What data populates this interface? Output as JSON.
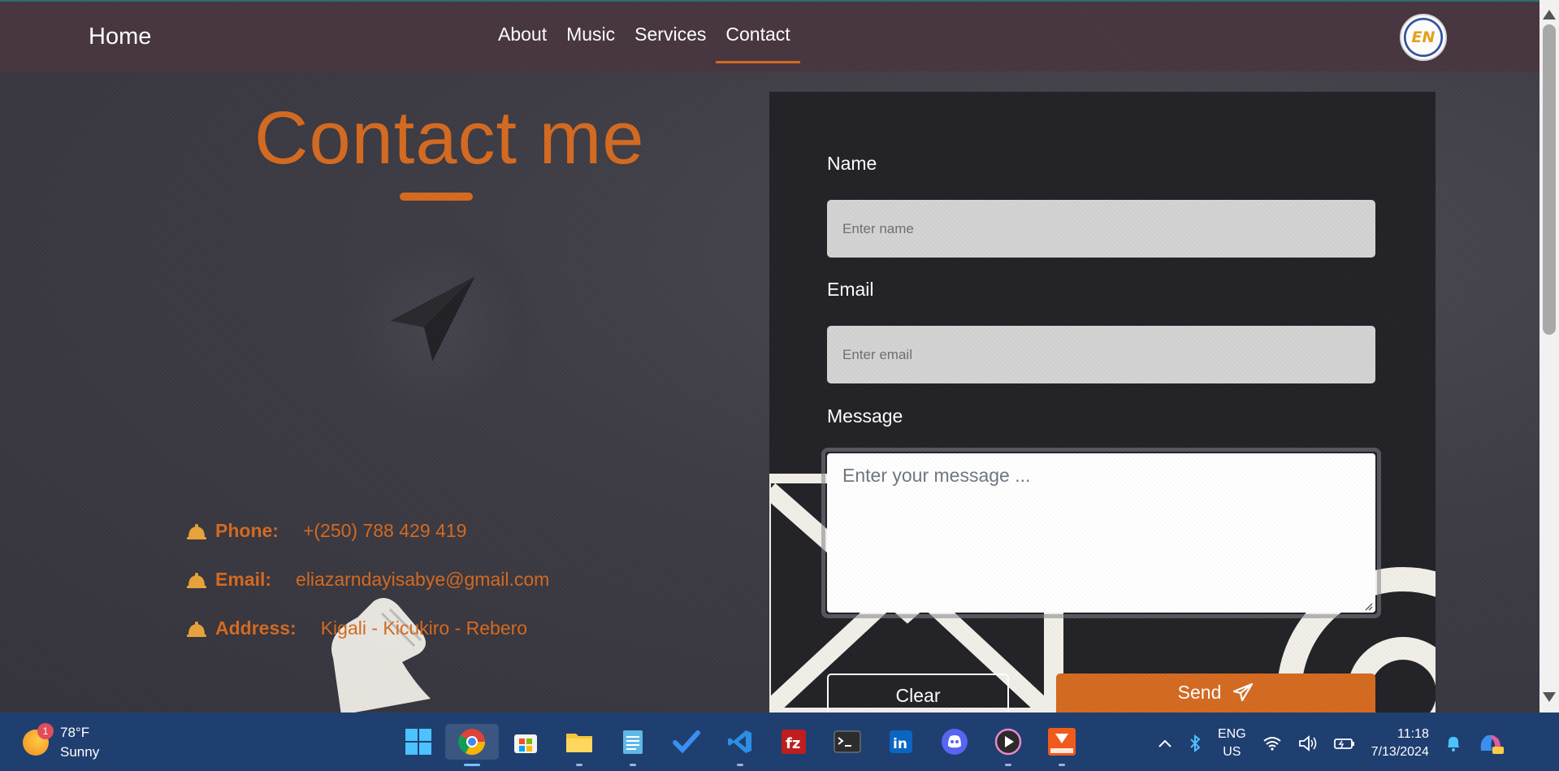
{
  "nav": {
    "brand": "Home",
    "links": [
      "About",
      "Music",
      "Services",
      "Contact"
    ],
    "active": "Contact",
    "logo_text": "EN"
  },
  "contact": {
    "title": "Contact me",
    "phone_label": "Phone:",
    "phone_value": "+(250) 788 429 419",
    "email_label": "Email:",
    "email_value": "eliazarndayisabye@gmail.com",
    "address_label": "Address:",
    "address_value": "Kigali - Kicukiro - Rebero"
  },
  "form": {
    "name_label": "Name",
    "name_placeholder": "Enter name",
    "email_label": "Email",
    "email_placeholder": "Enter email",
    "message_label": "Message",
    "message_placeholder": "Enter your message ...",
    "clear_label": "Clear",
    "send_label": "Send"
  },
  "taskbar": {
    "weather_badge": "1",
    "temperature": "78°F",
    "condition": "Sunny",
    "language_top": "ENG",
    "language_bottom": "US",
    "time": "11:18",
    "date": "7/13/2024",
    "apps": [
      "start",
      "chrome",
      "microsoft-store",
      "file-explorer",
      "notepad",
      "todo",
      "vscode",
      "filezilla",
      "terminal",
      "linkedin",
      "discord",
      "media-player",
      "reader"
    ]
  },
  "colors": {
    "accent": "#d46a21",
    "navbar": "#47363f",
    "card": "#232226",
    "taskbar": "#1f3f70"
  }
}
